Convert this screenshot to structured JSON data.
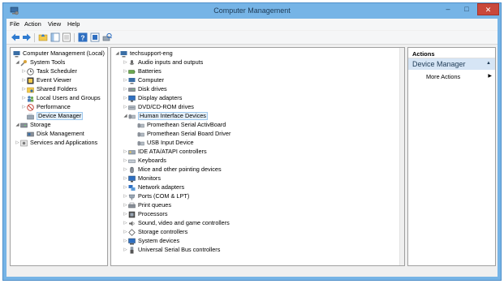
{
  "window": {
    "title": "Computer Management"
  },
  "menu": [
    "File",
    "Action",
    "View",
    "Help"
  ],
  "toolbar": {
    "icons": [
      "back-arrow-icon",
      "forward-arrow-icon",
      "up-folder-icon",
      "show-hide-tree-icon",
      "properties-icon",
      "help-icon",
      "console-icon",
      "scan-hardware-icon"
    ]
  },
  "left_tree": [
    {
      "label": "Computer Management (Local)",
      "icon": "computer-management-icon",
      "twisty": ""
    },
    {
      "label": "System Tools",
      "icon": "system-tools-icon",
      "twisty": "◢"
    },
    {
      "label": "Task Scheduler",
      "icon": "task-scheduler-icon",
      "twisty": "▷"
    },
    {
      "label": "Event Viewer",
      "icon": "event-viewer-icon",
      "twisty": "▷"
    },
    {
      "label": "Shared Folders",
      "icon": "shared-folders-icon",
      "twisty": "▷"
    },
    {
      "label": "Local Users and Groups",
      "icon": "users-icon",
      "twisty": "▷"
    },
    {
      "label": "Performance",
      "icon": "performance-icon",
      "twisty": "▷"
    },
    {
      "label": "Device Manager",
      "icon": "device-manager-icon",
      "twisty": ""
    },
    {
      "label": "Storage",
      "icon": "storage-icon",
      "twisty": "◢"
    },
    {
      "label": "Disk Management",
      "icon": "disk-management-icon",
      "twisty": ""
    },
    {
      "label": "Services and Applications",
      "icon": "services-icon",
      "twisty": "▷"
    }
  ],
  "device_tree": [
    {
      "label": "techsupport-eng",
      "icon": "computer-icon",
      "twisty": "◢"
    },
    {
      "label": "Audio inputs and outputs",
      "icon": "audio-icon",
      "twisty": "▷"
    },
    {
      "label": "Batteries",
      "icon": "battery-icon",
      "twisty": "▷"
    },
    {
      "label": "Computer",
      "icon": "computer-icon",
      "twisty": "▷"
    },
    {
      "label": "Disk drives",
      "icon": "disk-drive-icon",
      "twisty": "▷"
    },
    {
      "label": "Display adapters",
      "icon": "display-adapter-icon",
      "twisty": "▷"
    },
    {
      "label": "DVD/CD-ROM drives",
      "icon": "dvd-drive-icon",
      "twisty": "▷"
    },
    {
      "label": "Human Interface Devices",
      "icon": "hid-icon",
      "twisty": "◢"
    },
    {
      "label": "Promethean Serial ActivBoard",
      "icon": "hid-device-icon",
      "twisty": ""
    },
    {
      "label": "Promethean Serial Board Driver",
      "icon": "hid-device-icon",
      "twisty": ""
    },
    {
      "label": "USB Input Device",
      "icon": "hid-device-icon",
      "twisty": ""
    },
    {
      "label": "IDE ATA/ATAPI controllers",
      "icon": "ide-controller-icon",
      "twisty": "▷"
    },
    {
      "label": "Keyboards",
      "icon": "keyboard-icon",
      "twisty": "▷"
    },
    {
      "label": "Mice and other pointing devices",
      "icon": "mouse-icon",
      "twisty": "▷"
    },
    {
      "label": "Monitors",
      "icon": "monitor-icon",
      "twisty": "▷"
    },
    {
      "label": "Network adapters",
      "icon": "network-adapter-icon",
      "twisty": "▷"
    },
    {
      "label": "Ports (COM & LPT)",
      "icon": "port-icon",
      "twisty": "▷"
    },
    {
      "label": "Print queues",
      "icon": "printer-icon",
      "twisty": "▷"
    },
    {
      "label": "Processors",
      "icon": "processor-icon",
      "twisty": "▷"
    },
    {
      "label": "Sound, video and game controllers",
      "icon": "sound-icon",
      "twisty": "▷"
    },
    {
      "label": "Storage controllers",
      "icon": "storage-controller-icon",
      "twisty": "▷"
    },
    {
      "label": "System devices",
      "icon": "system-device-icon",
      "twisty": "▷"
    },
    {
      "label": "Universal Serial Bus controllers",
      "icon": "usb-icon",
      "twisty": "▷"
    }
  ],
  "actions": {
    "header": "Actions",
    "section": "Device Manager",
    "section_arrow": "▲",
    "item": "More Actions",
    "item_arrow": "▶"
  },
  "window_buttons": {
    "minimize": "–",
    "maximize": "□",
    "close": "✕"
  },
  "colors": {
    "titlebar": "#76b4e6",
    "close_button": "#c9483b",
    "selection": "#e5f1fb"
  }
}
